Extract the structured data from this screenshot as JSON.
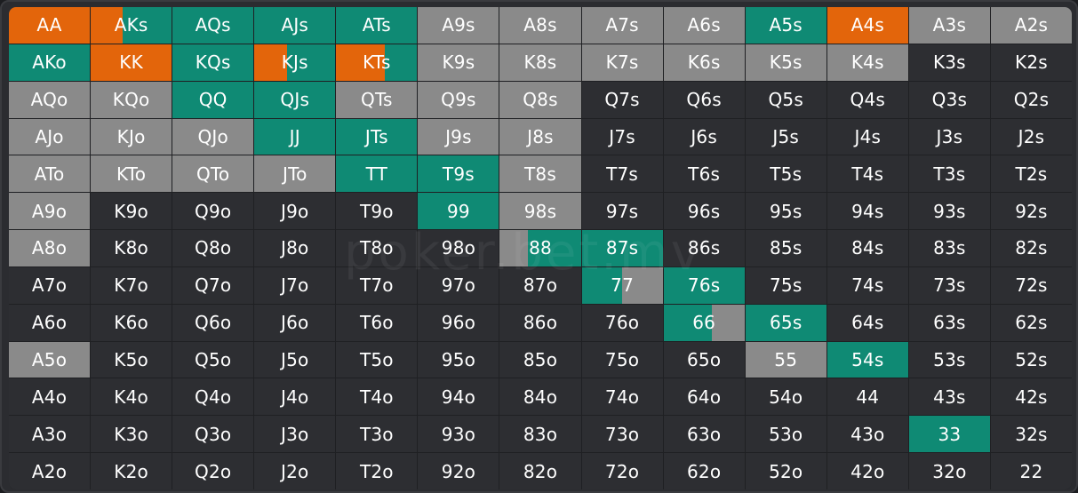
{
  "colors": {
    "raise": "#e3650b",
    "call": "#0f8a74",
    "fold": "#8a8a8a",
    "empty": "#2d2e32",
    "text": "#ffffff"
  },
  "watermark": "poker.bet.mv",
  "hands": [
    [
      "AA",
      "AKs",
      "AQs",
      "AJs",
      "ATs",
      "A9s",
      "A8s",
      "A7s",
      "A6s",
      "A5s",
      "A4s",
      "A3s",
      "A2s"
    ],
    [
      "AKo",
      "KK",
      "KQs",
      "KJs",
      "KTs",
      "K9s",
      "K8s",
      "K7s",
      "K6s",
      "K5s",
      "K4s",
      "K3s",
      "K2s"
    ],
    [
      "AQo",
      "KQo",
      "QQ",
      "QJs",
      "QTs",
      "Q9s",
      "Q8s",
      "Q7s",
      "Q6s",
      "Q5s",
      "Q4s",
      "Q3s",
      "Q2s"
    ],
    [
      "AJo",
      "KJo",
      "QJo",
      "JJ",
      "JTs",
      "J9s",
      "J8s",
      "J7s",
      "J6s",
      "J5s",
      "J4s",
      "J3s",
      "J2s"
    ],
    [
      "ATo",
      "KTo",
      "QTo",
      "JTo",
      "TT",
      "T9s",
      "T8s",
      "T7s",
      "T6s",
      "T5s",
      "T4s",
      "T3s",
      "T2s"
    ],
    [
      "A9o",
      "K9o",
      "Q9o",
      "J9o",
      "T9o",
      "99",
      "98s",
      "97s",
      "96s",
      "95s",
      "94s",
      "93s",
      "92s"
    ],
    [
      "A8o",
      "K8o",
      "Q8o",
      "J8o",
      "T8o",
      "98o",
      "88",
      "87s",
      "86s",
      "85s",
      "84s",
      "83s",
      "82s"
    ],
    [
      "A7o",
      "K7o",
      "Q7o",
      "J7o",
      "T7o",
      "97o",
      "87o",
      "77",
      "76s",
      "75s",
      "74s",
      "73s",
      "72s"
    ],
    [
      "A6o",
      "K6o",
      "Q6o",
      "J6o",
      "T6o",
      "96o",
      "86o",
      "76o",
      "66",
      "65s",
      "64s",
      "63s",
      "62s"
    ],
    [
      "A5o",
      "K5o",
      "Q5o",
      "J5o",
      "T5o",
      "95o",
      "85o",
      "75o",
      "65o",
      "55",
      "54s",
      "53s",
      "52s"
    ],
    [
      "A4o",
      "K4o",
      "Q4o",
      "J4o",
      "T4o",
      "94o",
      "84o",
      "74o",
      "64o",
      "54o",
      "44",
      "43s",
      "42s"
    ],
    [
      "A3o",
      "K3o",
      "Q3o",
      "J3o",
      "T3o",
      "93o",
      "83o",
      "73o",
      "63o",
      "53o",
      "43o",
      "33",
      "32s"
    ],
    [
      "A2o",
      "K2o",
      "Q2o",
      "J2o",
      "T2o",
      "92o",
      "82o",
      "72o",
      "62o",
      "52o",
      "42o",
      "32o",
      "22"
    ]
  ],
  "mix": {
    "AA": [
      [
        "raise",
        1
      ]
    ],
    "AKs": [
      [
        "raise",
        0.4
      ],
      [
        "call",
        0.6
      ]
    ],
    "AQs": [
      [
        "call",
        1
      ]
    ],
    "AJs": [
      [
        "call",
        1
      ]
    ],
    "ATs": [
      [
        "call",
        1
      ]
    ],
    "A9s": [
      [
        "fold",
        1
      ]
    ],
    "A8s": [
      [
        "fold",
        1
      ]
    ],
    "A7s": [
      [
        "fold",
        1
      ]
    ],
    "A6s": [
      [
        "fold",
        1
      ]
    ],
    "A5s": [
      [
        "call",
        1
      ]
    ],
    "A4s": [
      [
        "raise",
        1
      ]
    ],
    "A3s": [
      [
        "fold",
        1
      ]
    ],
    "A2s": [
      [
        "fold",
        1
      ]
    ],
    "AKo": [
      [
        "call",
        1
      ]
    ],
    "KK": [
      [
        "raise",
        1
      ]
    ],
    "KQs": [
      [
        "call",
        1
      ]
    ],
    "KJs": [
      [
        "raise",
        0.4
      ],
      [
        "call",
        0.6
      ]
    ],
    "KTs": [
      [
        "raise",
        0.6
      ],
      [
        "call",
        0.4
      ]
    ],
    "K9s": [
      [
        "fold",
        1
      ]
    ],
    "K8s": [
      [
        "fold",
        1
      ]
    ],
    "K7s": [
      [
        "fold",
        1
      ]
    ],
    "K6s": [
      [
        "fold",
        1
      ]
    ],
    "K5s": [
      [
        "fold",
        1
      ]
    ],
    "K4s": [
      [
        "fold",
        1
      ]
    ],
    "AQo": [
      [
        "fold",
        1
      ]
    ],
    "KQo": [
      [
        "fold",
        1
      ]
    ],
    "QQ": [
      [
        "call",
        1
      ]
    ],
    "QJs": [
      [
        "call",
        1
      ]
    ],
    "QTs": [
      [
        "fold",
        1
      ]
    ],
    "Q9s": [
      [
        "fold",
        1
      ]
    ],
    "Q8s": [
      [
        "fold",
        1
      ]
    ],
    "AJo": [
      [
        "fold",
        1
      ]
    ],
    "KJo": [
      [
        "fold",
        1
      ]
    ],
    "QJo": [
      [
        "fold",
        1
      ]
    ],
    "JJ": [
      [
        "call",
        1
      ]
    ],
    "JTs": [
      [
        "call",
        1
      ]
    ],
    "J9s": [
      [
        "fold",
        1
      ]
    ],
    "J8s": [
      [
        "fold",
        1
      ]
    ],
    "ATo": [
      [
        "fold",
        1
      ]
    ],
    "KTo": [
      [
        "fold",
        1
      ]
    ],
    "QTo": [
      [
        "fold",
        1
      ]
    ],
    "JTo": [
      [
        "fold",
        1
      ]
    ],
    "TT": [
      [
        "call",
        1
      ]
    ],
    "T9s": [
      [
        "call",
        1
      ]
    ],
    "T8s": [
      [
        "fold",
        1
      ]
    ],
    "A9o": [
      [
        "fold",
        1
      ]
    ],
    "99": [
      [
        "call",
        1
      ]
    ],
    "98s": [
      [
        "fold",
        1
      ]
    ],
    "A8o": [
      [
        "fold",
        1
      ]
    ],
    "88": [
      [
        "fold",
        0.35
      ],
      [
        "call",
        0.65
      ]
    ],
    "87s": [
      [
        "call",
        1
      ]
    ],
    "77": [
      [
        "call",
        0.5
      ],
      [
        "fold",
        0.5
      ]
    ],
    "76s": [
      [
        "call",
        1
      ]
    ],
    "66": [
      [
        "call",
        0.6
      ],
      [
        "fold",
        0.4
      ]
    ],
    "65s": [
      [
        "call",
        1
      ]
    ],
    "A5o": [
      [
        "fold",
        1
      ]
    ],
    "55": [
      [
        "fold",
        1
      ]
    ],
    "54s": [
      [
        "call",
        1
      ]
    ],
    "33": [
      [
        "call",
        1
      ]
    ]
  }
}
